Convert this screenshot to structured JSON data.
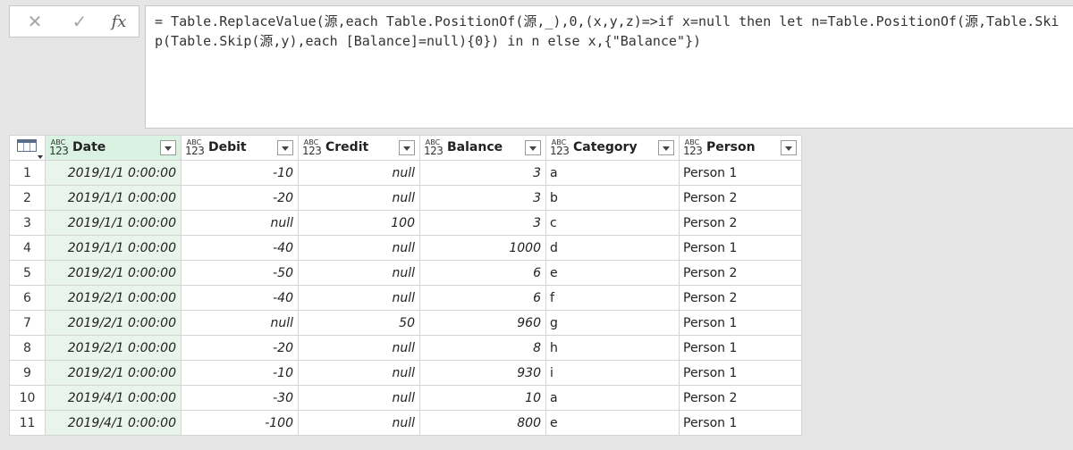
{
  "formula_bar": {
    "cancel_icon": "close-icon",
    "confirm_icon": "check-icon",
    "fx_label": "fx",
    "formula": "= Table.ReplaceValue(源,each Table.PositionOf(源,_),0,(x,y,z)=>if x=null then let n=Table.PositionOf(源,Table.Skip(Table.Skip(源,y),each [Balance]=null){0}) in n else x,{\"Balance\"})"
  },
  "grid": {
    "type_icon_top": "ABC",
    "type_icon_bottom": "123",
    "columns": [
      "Date",
      "Debit",
      "Credit",
      "Balance",
      "Category",
      "Person"
    ],
    "rows": [
      [
        "1",
        "2019/1/1 0:00:00",
        "-10",
        "null",
        "3",
        "a",
        "Person 1"
      ],
      [
        "2",
        "2019/1/1 0:00:00",
        "-20",
        "null",
        "3",
        "b",
        "Person 2"
      ],
      [
        "3",
        "2019/1/1 0:00:00",
        "null",
        "100",
        "3",
        "c",
        "Person 2"
      ],
      [
        "4",
        "2019/1/1 0:00:00",
        "-40",
        "null",
        "1000",
        "d",
        "Person 1"
      ],
      [
        "5",
        "2019/2/1 0:00:00",
        "-50",
        "null",
        "6",
        "e",
        "Person 2"
      ],
      [
        "6",
        "2019/2/1 0:00:00",
        "-40",
        "null",
        "6",
        "f",
        "Person 2"
      ],
      [
        "7",
        "2019/2/1 0:00:00",
        "null",
        "50",
        "960",
        "g",
        "Person 1"
      ],
      [
        "8",
        "2019/2/1 0:00:00",
        "-20",
        "null",
        "8",
        "h",
        "Person 1"
      ],
      [
        "9",
        "2019/2/1 0:00:00",
        "-10",
        "null",
        "930",
        "i",
        "Person 1"
      ],
      [
        "10",
        "2019/4/1 0:00:00",
        "-30",
        "null",
        "10",
        "a",
        "Person 2"
      ],
      [
        "11",
        "2019/4/1 0:00:00",
        "-100",
        "null",
        "800",
        "e",
        "Person 1"
      ]
    ]
  }
}
